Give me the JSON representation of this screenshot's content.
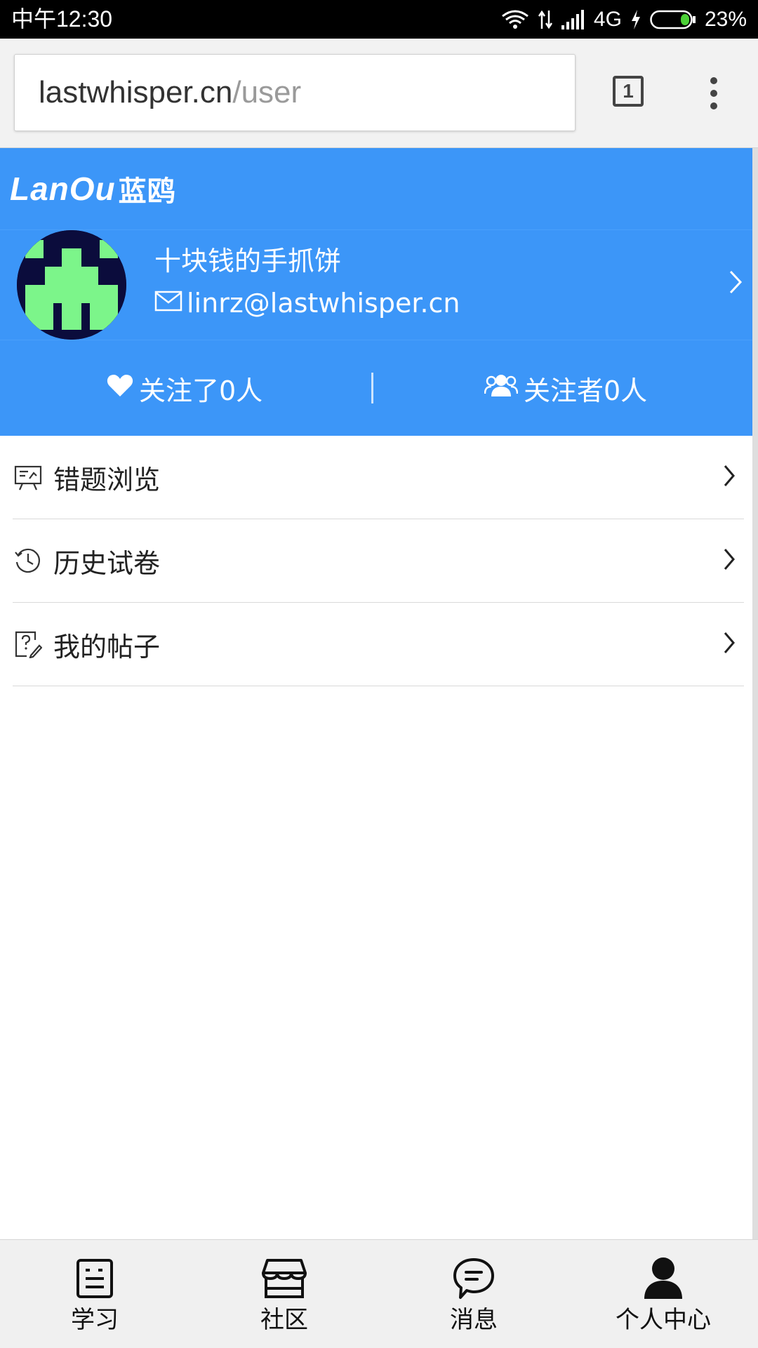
{
  "status_bar": {
    "time": "中午12:30",
    "network": "4G",
    "battery": "23%",
    "icons": [
      "wifi-icon",
      "data-transfer-icon",
      "signal-icon",
      "charging-icon",
      "battery-icon"
    ]
  },
  "browser": {
    "url_host": "lastwhisper.cn",
    "url_path": "/user",
    "tab_count": "1",
    "menu_icon": "overflow-menu-icon"
  },
  "brand": {
    "logo_latin": "LanOu",
    "logo_cn": "蓝鸥"
  },
  "profile": {
    "name": "十块钱的手抓饼",
    "email": "linrz@lastwhisper.cn",
    "avatar_icon": "pixel-identicon"
  },
  "follow": {
    "following": "关注了0人",
    "followers": "关注者0人"
  },
  "menu": [
    {
      "label": "错题浏览",
      "icon": "presentation-icon"
    },
    {
      "label": "历史试卷",
      "icon": "history-icon"
    },
    {
      "label": "我的帖子",
      "icon": "post-edit-icon"
    }
  ],
  "bottom_nav": [
    {
      "label": "学习",
      "icon": "notebook-icon"
    },
    {
      "label": "社区",
      "icon": "store-icon"
    },
    {
      "label": "消息",
      "icon": "chat-bubble-icon"
    },
    {
      "label": "个人中心",
      "icon": "person-icon"
    }
  ],
  "colors": {
    "header_blue": "#3c96f8",
    "avatar_bg": "#0b0c3c",
    "avatar_fg": "#7cf58a",
    "battery_green": "#4cd137"
  }
}
